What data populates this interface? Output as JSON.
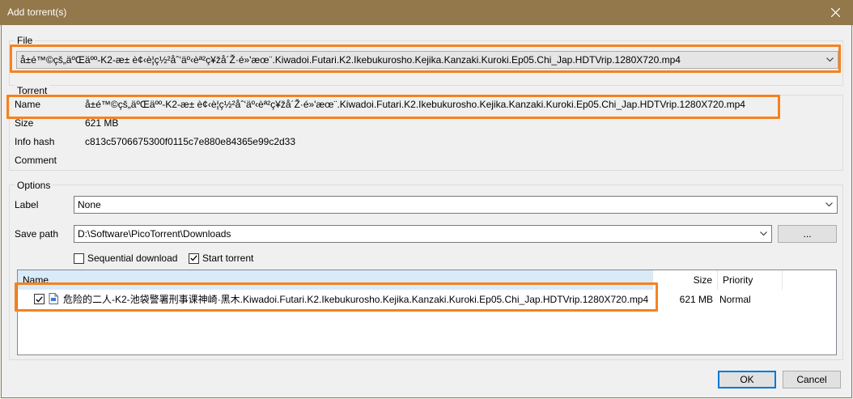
{
  "window": {
    "title": "Add torrent(s)"
  },
  "file_group": {
    "label": "File",
    "selected": "å±é™©çš„äºŒäºº-K2-æ± è¢‹è­¦ç½²åˆ‘äº‹èª²ç¥žå´Ž·é»'æœ¨.Kiwadoi.Futari.K2.Ikebukurosho.Kejika.Kanzaki.Kuroki.Ep05.Chi_Jap.HDTVrip.1280X720.mp4"
  },
  "torrent_group": {
    "label": "Torrent",
    "name_label": "Name",
    "name_value": "å±é™©çš„äºŒäºº-K2-æ± è¢‹è­¦ç½²åˆ‘äº‹èª²ç¥žå´Ž·é»'æœ¨.Kiwadoi.Futari.K2.Ikebukurosho.Kejika.Kanzaki.Kuroki.Ep05.Chi_Jap.HDTVrip.1280X720.mp4",
    "size_label": "Size",
    "size_value": "621 MB",
    "hash_label": "Info hash",
    "hash_value": "c813c5706675300f0115c7e880e84365e99c2d33",
    "comment_label": "Comment",
    "comment_value": ""
  },
  "options_group": {
    "label": "Options",
    "label_label": "Label",
    "label_value": "None",
    "save_path_label": "Save path",
    "save_path_value": "D:\\Software\\PicoTorrent\\Downloads",
    "browse_label": "...",
    "sequential_label": "Sequential download",
    "sequential_checked": false,
    "start_label": "Start torrent",
    "start_checked": true
  },
  "files_list": {
    "columns": [
      "Name",
      "Size",
      "Priority"
    ],
    "rows": [
      {
        "name": "危险的二人-K2-池袋警署刑事课神崎·黑木.Kiwadoi.Futari.K2.Ikebukurosho.Kejika.Kanzaki.Kuroki.Ep05.Chi_Jap.HDTVrip.1280X720.mp4",
        "size": "621 MB",
        "priority": "Normal",
        "checked": true
      }
    ]
  },
  "buttons": {
    "ok": "OK",
    "cancel": "Cancel"
  },
  "colors": {
    "highlight": "#f58220",
    "titlebar": "#93784b",
    "default_button_border": "#0078d7"
  }
}
